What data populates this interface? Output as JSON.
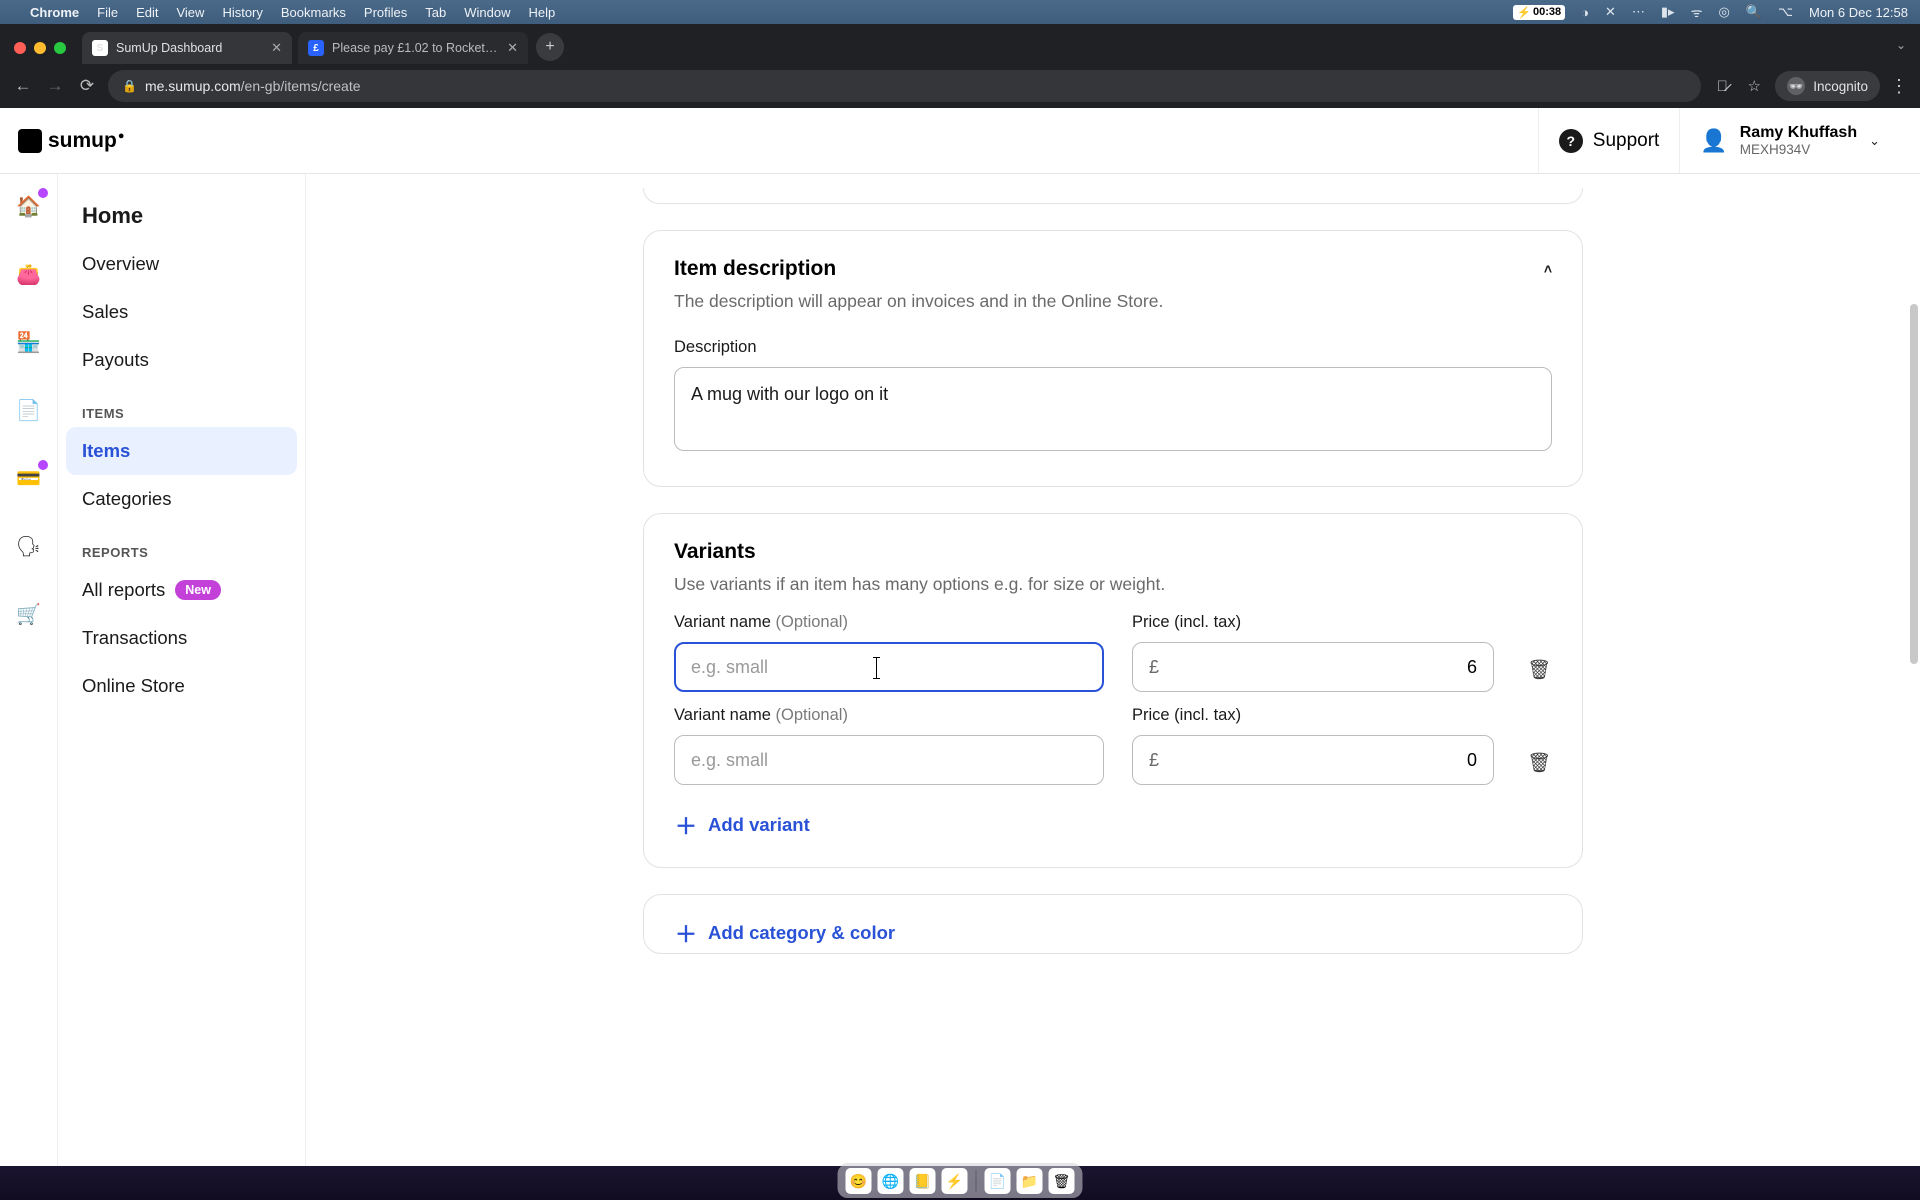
{
  "mac": {
    "app": "Chrome",
    "menus": [
      "File",
      "Edit",
      "View",
      "History",
      "Bookmarks",
      "Profiles",
      "Tab",
      "Window",
      "Help"
    ],
    "battery": "00:38",
    "clock": "Mon 6 Dec  12:58"
  },
  "browser": {
    "tabs": [
      {
        "title": "SumUp Dashboard"
      },
      {
        "title": "Please pay £1.02 to Rocket Ge"
      }
    ],
    "url_host": "me.sumup.com",
    "url_path": "/en-gb/items/create",
    "incognito": "Incognito"
  },
  "header": {
    "brand": "sumup",
    "support": "Support",
    "user_name": "Ramy Khuffash",
    "user_code": "MEXH934V"
  },
  "sidebar": {
    "home": "Home",
    "overview": "Overview",
    "sales": "Sales",
    "payouts": "Payouts",
    "group_items": "ITEMS",
    "items": "Items",
    "categories": "Categories",
    "group_reports": "REPORTS",
    "all_reports": "All reports",
    "new_pill": "New",
    "transactions": "Transactions",
    "online_store": "Online Store"
  },
  "desc_card": {
    "title": "Item description",
    "sub": "The description will appear on invoices and in the Online Store.",
    "label": "Description",
    "value": "A mug with our logo on it"
  },
  "variants": {
    "title": "Variants",
    "sub": "Use variants if an item has many options e.g. for size or weight.",
    "name_label": "Variant name ",
    "optional": "(Optional)",
    "price_label": "Price (incl. tax)",
    "placeholder": "e.g. small",
    "currency": "£",
    "rows": [
      {
        "name": "",
        "price": "6"
      },
      {
        "name": "",
        "price": "0"
      }
    ],
    "add": "Add variant"
  },
  "cat_card": {
    "add": "Add category & color"
  }
}
